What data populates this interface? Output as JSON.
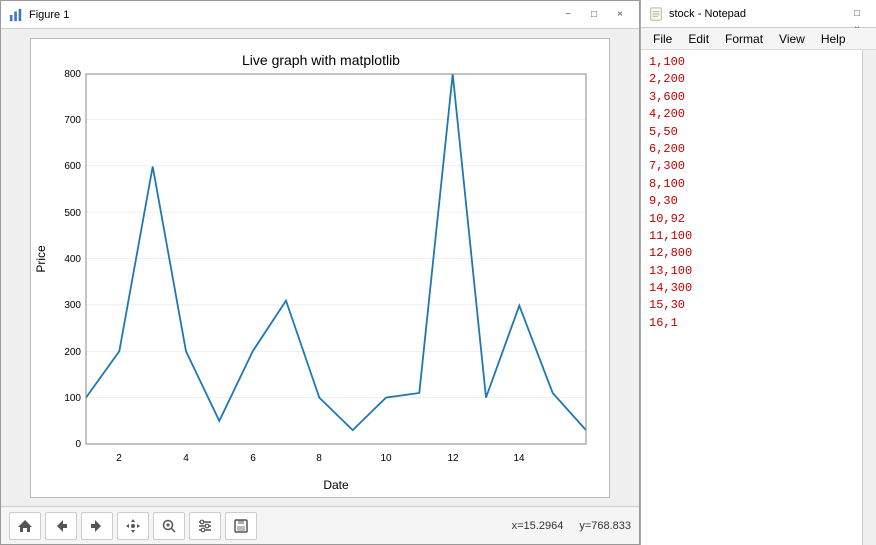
{
  "figure": {
    "title": "Figure 1",
    "chart_title": "Live graph with matplotlib",
    "x_label": "Date",
    "y_label": "Price",
    "status_x": "x=15.2964",
    "status_y": "y=768.833",
    "toolbar_buttons": [
      "home",
      "back",
      "forward",
      "move",
      "zoom",
      "configure",
      "save"
    ],
    "win_buttons": [
      "−",
      "□",
      "×"
    ],
    "data_points": [
      {
        "x": 1,
        "y": 100
      },
      {
        "x": 2,
        "y": 200
      },
      {
        "x": 3,
        "y": 600
      },
      {
        "x": 4,
        "y": 200
      },
      {
        "x": 5,
        "y": 60
      },
      {
        "x": 6,
        "y": 200
      },
      {
        "x": 7,
        "y": 310
      },
      {
        "x": 8,
        "y": 100
      },
      {
        "x": 9,
        "y": 30
      },
      {
        "x": 10,
        "y": 100
      },
      {
        "x": 11,
        "y": 110
      },
      {
        "x": 12,
        "y": 800
      },
      {
        "x": 13,
        "y": 100
      },
      {
        "x": 14,
        "y": 300
      },
      {
        "x": 15,
        "y": 110
      },
      {
        "x": 16,
        "y": 30
      }
    ],
    "y_ticks": [
      0,
      100,
      200,
      300,
      400,
      500,
      600,
      700,
      800
    ],
    "x_ticks": [
      2,
      4,
      6,
      8,
      10,
      12,
      14
    ]
  },
  "notepad": {
    "title": "stock - Notepad",
    "menu": {
      "file": "File",
      "edit": "Edit",
      "format": "Format",
      "view": "View",
      "help": "Help"
    },
    "lines": [
      "1,100",
      "2,200",
      "3,600",
      "4,200",
      "5,50",
      "6,200",
      "7,300",
      "8,100",
      "9,30",
      "10,92",
      "11,100",
      "12,800",
      "13,100",
      "14,300",
      "15,30",
      "16,1"
    ]
  }
}
